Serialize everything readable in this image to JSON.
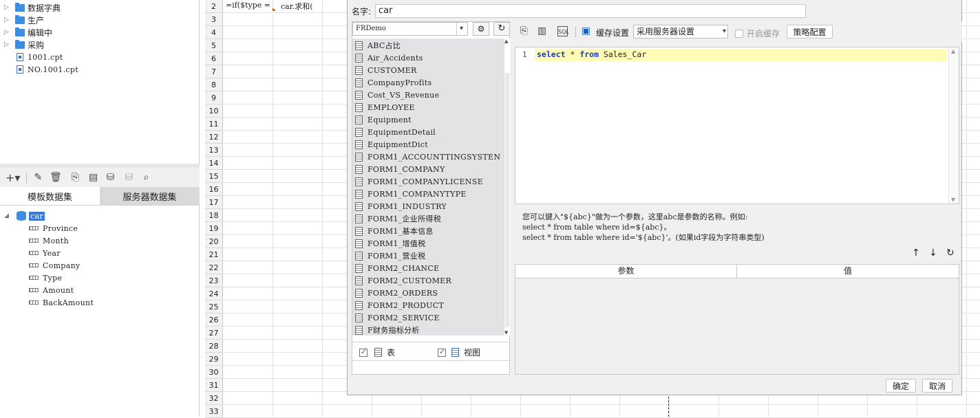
{
  "tree": {
    "folders": [
      "数据字典",
      "生产",
      "编辑中",
      "采购"
    ],
    "files": [
      "1001.cpt",
      "NO.1001.cpt"
    ]
  },
  "dataset_tabs": {
    "template": "模板数据集",
    "server": "服务器数据集"
  },
  "dataset": {
    "name": "car",
    "fields": [
      "Province",
      "Month",
      "Year",
      "Company",
      "Type",
      "Amount",
      "BackAmount"
    ]
  },
  "sheet": {
    "rows": [
      "2",
      "3",
      "4",
      "5",
      "6",
      "7",
      "8",
      "9",
      "10",
      "11",
      "12",
      "13",
      "14",
      "15",
      "16",
      "17",
      "18",
      "19",
      "20",
      "21",
      "22",
      "23",
      "24",
      "25",
      "26",
      "27",
      "28",
      "29",
      "30",
      "31",
      "32",
      "33"
    ],
    "cell_b2": "=if($type =",
    "cell_c2": "car.求和("
  },
  "dialog": {
    "name_label": "名字:",
    "name_value": "car",
    "connection": "FRDemo",
    "tables": [
      "ABC占比",
      "Air_Accidents",
      "CUSTOMER",
      "CompanyProfits",
      "Cost_VS_Revenue",
      "EMPLOYEE",
      "Equipment",
      "EquipmentDetail",
      "EquipmentDict",
      "FORM1_ACCOUNTTINGSYSTEN",
      "FORM1_COMPANY",
      "FORM1_COMPANYLICENSE",
      "FORM1_COMPANYTYPE",
      "FORM1_INDUSTRY",
      "FORM1_企业所得税",
      "FORM1_基本信息",
      "FORM1_增值税",
      "FORM1_营业税",
      "FORM2_CHANCE",
      "FORM2_CUSTOMER",
      "FORM2_ORDERS",
      "FORM2_PRODUCT",
      "FORM2_SERVICE",
      "F财务指标分析"
    ],
    "show_table_label": "表",
    "show_view_label": "视图",
    "cache_label": "缓存设置",
    "cache_option": "采用服务器设置",
    "enable_cache_label": "开启缓存",
    "strategy_button": "策略配置",
    "sql_line_no": "1",
    "sql_kw1": "select",
    "sql_star": " * ",
    "sql_kw2": "from",
    "sql_rest": " Sales_Car",
    "hint_line1": "您可以键入\"${abc}\"做为一个参数，这里abc是参数的名称。例如:",
    "hint_line2": "select * from table where id=${abc}。",
    "hint_line3": "select * from table where id='${abc}'。(如果id字段为字符串类型)",
    "param_col": "参数",
    "value_col": "值",
    "ok": "确定",
    "cancel": "取消"
  }
}
